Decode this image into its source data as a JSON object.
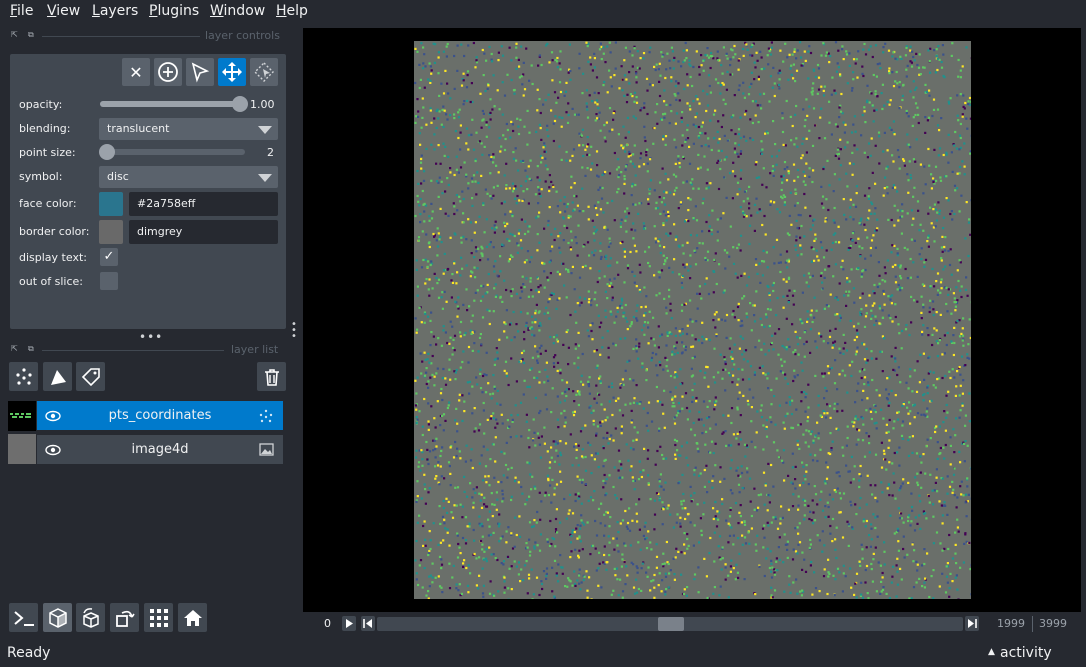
{
  "menubar": {
    "items": [
      {
        "key": "F",
        "rest": "ile"
      },
      {
        "key": "V",
        "rest": "iew"
      },
      {
        "key": "L",
        "rest": "ayers"
      },
      {
        "key": "P",
        "rest": "lugins"
      },
      {
        "key": "W",
        "rest": "indow"
      },
      {
        "key": "H",
        "rest": "elp"
      }
    ]
  },
  "layer_controls": {
    "title": "layer controls",
    "tools": [
      "close-icon",
      "add-point-icon",
      "select-icon",
      "pan-zoom-icon",
      "transform-icon"
    ],
    "opacity": {
      "label": "opacity:",
      "value": "1.00",
      "level": 1.0
    },
    "blending": {
      "label": "blending:",
      "value": "translucent"
    },
    "point_size": {
      "label": "point size:",
      "value": "2",
      "level": 0.0
    },
    "symbol": {
      "label": "symbol:",
      "value": "disc"
    },
    "face_color": {
      "label": "face color:",
      "value": "#2a758eff",
      "swatch": "#2a758e"
    },
    "border_color": {
      "label": "border color:",
      "value": "dimgrey",
      "swatch": "#696969"
    },
    "display_text": {
      "label": "display text:",
      "checked": true
    },
    "out_of_slice": {
      "label": "out of slice:",
      "checked": false
    }
  },
  "layer_list": {
    "title": "layer list",
    "layers": [
      {
        "name": "pts_coordinates",
        "selected": true,
        "type_icon": "points-icon"
      },
      {
        "name": "image4d",
        "selected": false,
        "type_icon": "image-icon"
      }
    ]
  },
  "dims": {
    "start": "0",
    "current": "1999",
    "max": "3999",
    "position_fraction": 0.5
  },
  "status": {
    "text": "Ready",
    "activity": "activity"
  },
  "colors": {
    "accent": "#007acc",
    "background": "#262930",
    "panel": "#414851",
    "points": [
      "#fde725",
      "#5ec962",
      "#21918c",
      "#3b528b",
      "#440154"
    ]
  }
}
